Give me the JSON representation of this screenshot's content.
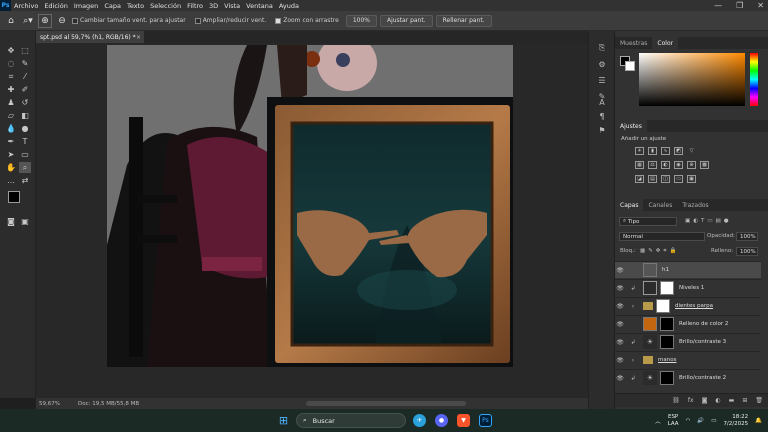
{
  "menubar": {
    "logo": "Ps",
    "items": [
      "Archivo",
      "Edición",
      "Imagen",
      "Capa",
      "Texto",
      "Selección",
      "Filtro",
      "3D",
      "Vista",
      "Ventana",
      "Ayuda"
    ],
    "win_minimize": "—",
    "win_restore": "❐",
    "win_close": "✕"
  },
  "options": {
    "resize_windows": "Cambiar tamaño vent. para ajustar",
    "zoom_all": "Ampliar/reducir vent.",
    "scrubby_zoom": "Zoom con arrastre",
    "zoom_100": "100%",
    "fit_screen": "Ajustar pant.",
    "fill_screen": "Rellenar pant."
  },
  "document": {
    "tab_title": "spt.psd al 59,7% (h1, RGB/16) *",
    "tab_close": "×"
  },
  "status": {
    "zoom": "59,67%",
    "doc_size": "Doc: 19,5 MB/55,8 MB"
  },
  "panels": {
    "color_tabs": [
      "Muestras",
      "Color"
    ],
    "adjust_tab": "Ajustes",
    "adjust_hint": "Añadir un ajuste",
    "layer_tabs": [
      "Capas",
      "Canales",
      "Trazados"
    ],
    "kind_filter": "Tipo",
    "blend_mode": "Normal",
    "opacity_label": "Opacidad:",
    "opacity_value": "100%",
    "lock_label": "Bloq.:",
    "fill_label": "Relleno:",
    "fill_value": "100%"
  },
  "layers": [
    {
      "name": "h1",
      "type": "layer",
      "selected": true
    },
    {
      "name": "Niveles 1",
      "type": "adjustment",
      "selected": false
    },
    {
      "name": "dientes parpa",
      "type": "group",
      "selected": false
    },
    {
      "name": "Relleno de color 2",
      "type": "fill",
      "selected": false,
      "color": "#c4650f"
    },
    {
      "name": "Brillo/contraste 3",
      "type": "adjustment",
      "selected": false
    },
    {
      "name": "manos",
      "type": "group",
      "selected": false
    },
    {
      "name": "Brillo/contraste 2",
      "type": "adjustment",
      "selected": false
    }
  ],
  "taskbar": {
    "search_placeholder": "Buscar",
    "language": "ESP",
    "region": "LAA",
    "time": "18:22",
    "date": "7/2/2025"
  },
  "colors": {
    "fill_layer_swatch": "#c4650f",
    "accent": "#31a8ff"
  }
}
